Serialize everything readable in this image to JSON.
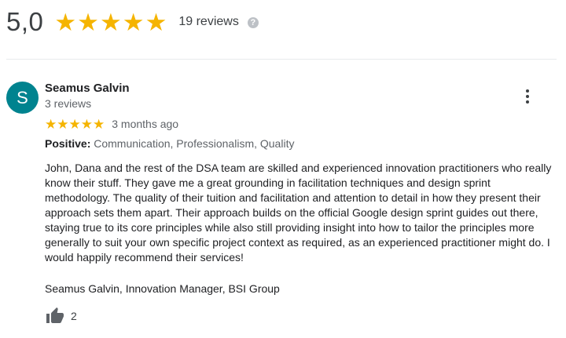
{
  "summary": {
    "score": "5,0",
    "stars_filled": 5,
    "review_count": "19 reviews",
    "help_icon_glyph": "?"
  },
  "review": {
    "avatar_letter": "S",
    "avatar_color": "#00838f",
    "reviewer_name": "Seamus Galvin",
    "reviewer_review_count": "3 reviews",
    "rating": 5,
    "time": "3 months ago",
    "attributes_label": "Positive:",
    "attributes_value": "Communication, Professionalism, Quality",
    "text": "John, Dana and the rest of the DSA team are skilled and experienced innovation practitioners who really know their stuff. They gave me a great grounding in facilitation techniques and design sprint methodology. The quality of their tuition and facilitation and attention to detail in how they present their approach sets them apart. Their approach builds on the official Google design sprint guides out there, staying true to its core principles while also still providing insight into how to tailor the principles more generally to suit your own specific project context as required, as an experienced practitioner might do. I would happily recommend their services!",
    "signature": "Seamus Galvin, Innovation Manager, BSI Group",
    "like_count": "2"
  },
  "icons": {
    "star": "star-icon",
    "help": "help-circle-icon",
    "more": "more-vert-icon",
    "like": "thumb-up-icon"
  },
  "colors": {
    "star": "#f5b400",
    "avatar": "#00838f",
    "divider": "#e8eaed",
    "secondary_text": "#5f6368"
  }
}
